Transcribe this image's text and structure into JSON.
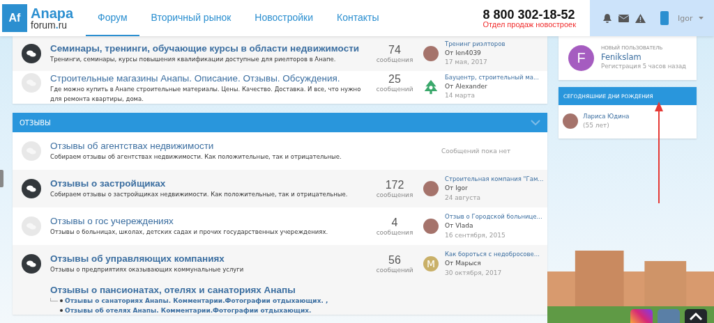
{
  "header": {
    "logo": {
      "mark": "Af",
      "name": "Anapa",
      "domain_left": "forum",
      "domain_dot": ".",
      "domain_right": "ru"
    },
    "nav": [
      {
        "label": "Форум",
        "selected": true
      },
      {
        "label": "Вторичный рынок",
        "selected": false
      },
      {
        "label": "Новостройки",
        "selected": false
      },
      {
        "label": "Контакты",
        "selected": false
      }
    ],
    "phone": "8 800 302-18-52",
    "phone_note": "Отдел продаж новостроек",
    "user": "Igor"
  },
  "sections": [
    {
      "forums": [
        {
          "title": "Семинары, тренинги, обучающие курсы в области недвижимости",
          "description": "Тренинги, семинары, курсы повышения квалификации доступные для риелторов в Анапе.",
          "unread": true,
          "has_icon": true,
          "count": "74",
          "count_label": "сообщения",
          "last": {
            "kind": "photo",
            "title": "Тренинг риэлторов",
            "by": "От len4039",
            "date": "17 мая, 2017"
          }
        },
        {
          "title": "Строительные магазины Анапы. Описание. Отзывы. Обсуждения.",
          "description": "Где можно купить в Анапе строительные материалы. Цены. Качество. Доставка. И все, что нужно для ремонта квартиры, дома.",
          "unread": false,
          "has_icon": true,
          "count": "25",
          "count_label": "сообщений",
          "last": {
            "kind": "logo",
            "title": "Бауцентр, строительный ма...",
            "by": "От Alexander",
            "date": "14 марта"
          }
        }
      ]
    },
    {
      "title": "ОТЗЫВЫ",
      "forums": [
        {
          "title": "Отзывы об агентствах недвижимости",
          "description": "Собираем отзывы об агентствах недвижимости. Как положительные, так и отрицательные.",
          "unread": false,
          "has_icon": true,
          "empty_note": "Сообщений пока нет"
        },
        {
          "title": "Отзывы о застройщиках",
          "description": "Собираем отзывы о застройщиках недвижимости. Как положительные, так и отрицательные.",
          "unread": true,
          "has_icon": true,
          "count": "172",
          "count_label": "сообщения",
          "last": {
            "kind": "photo",
            "title": "Строительная компания \"Гам...",
            "by": "От Igor",
            "date": "24 августа"
          }
        },
        {
          "title": "Отзывы о гос учереждениях",
          "description": "Отзывы о больницах, школах, детских садах и прочих государственных учереждениях.",
          "unread": false,
          "has_icon": true,
          "count": "4",
          "count_label": "сообщения",
          "last": {
            "kind": "photo",
            "title": "Отзыв о Городской больнице...",
            "by": "От Vlada",
            "date": "16 сентября, 2015"
          }
        },
        {
          "title": "Отзывы об управляющих компаниях",
          "description": "Отзывы о предприятиях оказывающих коммунальные услуги",
          "unread": true,
          "has_icon": true,
          "count": "56",
          "count_label": "сообщений",
          "last": {
            "kind": "letter",
            "letter": "M",
            "color": "#c9b068",
            "title": "Как бороться с недобросове...",
            "by": "От Марыся",
            "date": "30 октября, 2017"
          }
        },
        {
          "title": "Отзывы о пансионатах, отелях и санаториях Анапы",
          "unread": true,
          "has_icon": false,
          "subforums": [
            "Отзывы о санаториях Анапы. Комментарии.Фотографии отдыхающих. ,",
            "Отзывы об отелях Анапы. Комментарии.Фотографии отдыхающих."
          ]
        }
      ]
    }
  ],
  "sidebar": {
    "new_user": {
      "letter": "F",
      "color": "#a55cc0",
      "label": "НОВЫЙ ПОЛЬЗОВАТЕЛЬ",
      "name": "Fenikslam",
      "note": "Регистрация 5 часов назад"
    },
    "birthdays": {
      "title": "СЕГОДНЯШНИЕ ДНИ РОЖДЕНИЯ",
      "people": [
        {
          "name": "Лариса Юдина",
          "age": "(55 лет)"
        }
      ]
    }
  }
}
